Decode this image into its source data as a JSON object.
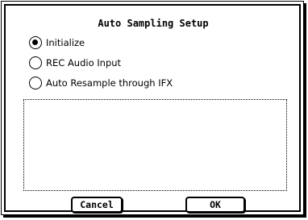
{
  "dialog": {
    "title": "Auto Sampling Setup"
  },
  "options": [
    {
      "label": "Initialize",
      "selected": true
    },
    {
      "label": "REC Audio Input",
      "selected": false
    },
    {
      "label": "Auto Resample through IFX",
      "selected": false
    }
  ],
  "buttons": {
    "cancel_label": "Cancel",
    "ok_label": "OK"
  }
}
